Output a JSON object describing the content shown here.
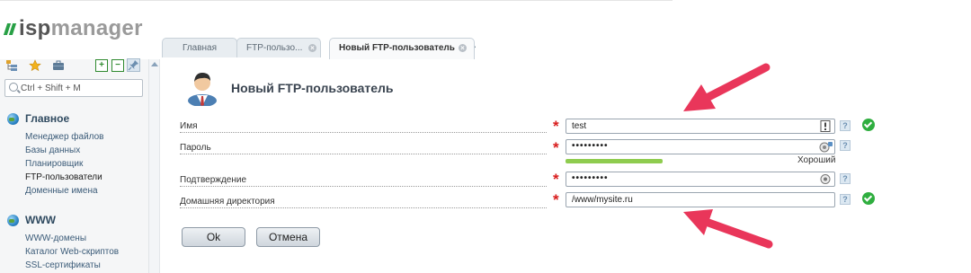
{
  "brand": {
    "logo_text_a": "isp",
    "logo_text_b": "manager",
    "accent_color": "#28a045"
  },
  "tabs": [
    {
      "label": "Главная",
      "active": false,
      "closable": false
    },
    {
      "label": "FTP-пользо...",
      "active": false,
      "closable": true
    },
    {
      "label": "Новый FTP-пользователь",
      "active": true,
      "closable": true
    }
  ],
  "tab_close_glyph": "×",
  "tab_separator": ">",
  "sidebar": {
    "toolbar_icons": [
      "tree-icon",
      "star-icon",
      "briefcase-icon",
      "expand-icon",
      "collapse-icon",
      "pin-icon"
    ],
    "search_placeholder": "Ctrl + Shift + M",
    "sections": [
      {
        "title": "Главное",
        "items": [
          {
            "label": "Менеджер файлов",
            "current": false
          },
          {
            "label": "Базы данных",
            "current": false
          },
          {
            "label": "Планировщик",
            "current": false
          },
          {
            "label": "FTP-пользователи",
            "current": true
          },
          {
            "label": "Доменные имена",
            "current": false
          }
        ]
      },
      {
        "title": "WWW",
        "items": [
          {
            "label": "WWW-домены",
            "current": false
          },
          {
            "label": "Каталог Web-скриптов",
            "current": false
          },
          {
            "label": "SSL-сертификаты",
            "current": false
          }
        ]
      }
    ]
  },
  "form": {
    "title": "Новый FTP-пользователь",
    "required_mark": "*",
    "help_glyph": "?",
    "fields": {
      "name": {
        "label": "Имя",
        "value": "test",
        "required": true,
        "valid": true
      },
      "password": {
        "label": "Пароль",
        "value": "•••••••••",
        "required": true,
        "strength_label": "Хороший",
        "strength_fraction": 0.36
      },
      "confirm": {
        "label": "Подтверждение",
        "value": "•••••••••",
        "required": true
      },
      "homedir": {
        "label": "Домашняя директория",
        "value": "/www/mysite.ru",
        "required": true,
        "valid": true
      }
    },
    "buttons": {
      "ok": "Ok",
      "cancel": "Отмена"
    }
  },
  "colors": {
    "required": "#d81c1c",
    "valid": "#2fae3f",
    "strength": "#8fcc4f",
    "annotation_arrow": "#e9365a"
  }
}
